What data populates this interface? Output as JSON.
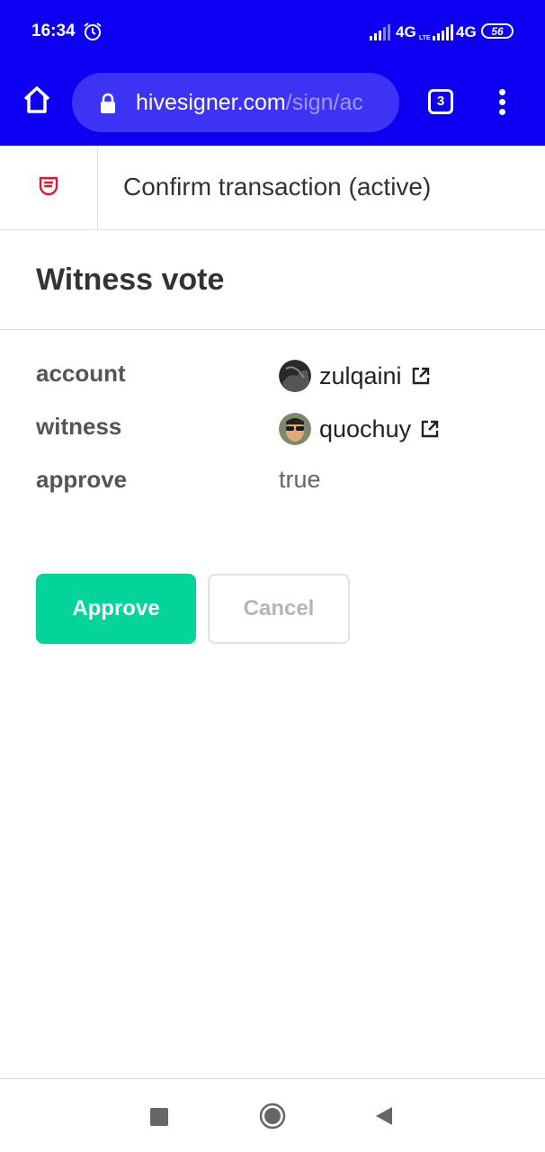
{
  "status_bar": {
    "time": "16:34",
    "network_1": "4G",
    "lte_tag": "LTE",
    "network_2": "4G",
    "battery": "56",
    "icons": [
      "alarm-icon",
      "signal-icon",
      "signal-icon",
      "battery-icon"
    ]
  },
  "browser": {
    "url_host": "hivesigner.com",
    "url_path": "/sign/ac",
    "tab_count": "3",
    "icons": [
      "home-icon",
      "lock-icon",
      "tabs-icon",
      "more-menu-icon"
    ],
    "bar_color": "#0d00f2"
  },
  "header": {
    "title": "Confirm transaction (active)",
    "logo_icon": "hivesigner-shield-icon",
    "logo_color": "#e31337"
  },
  "operation": {
    "title": "Witness vote",
    "fields": [
      {
        "label": "account",
        "value": "zulqaini"
      },
      {
        "label": "witness",
        "value": "quochuy"
      },
      {
        "label": "approve",
        "value": "true"
      }
    ]
  },
  "buttons": {
    "approve": "Approve",
    "cancel": "Cancel",
    "approve_color": "#04d39a"
  },
  "nav": {
    "icons": [
      "recent-apps-icon",
      "home-icon",
      "back-icon"
    ]
  }
}
